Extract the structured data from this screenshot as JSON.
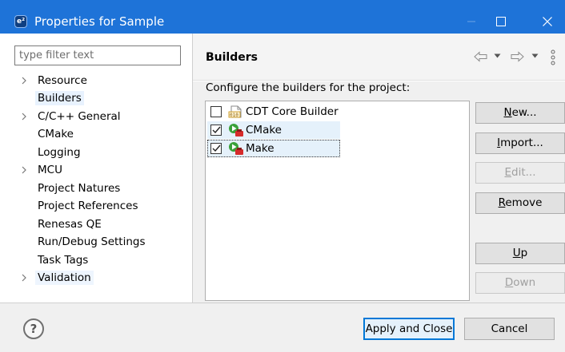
{
  "window": {
    "title": "Properties for Sample",
    "app_icon": "e²",
    "minimize_icon": "minimize-icon",
    "maximize_icon": "maximize-icon",
    "close_icon": "close-icon",
    "titlebar_color": "#1e73d8"
  },
  "filter": {
    "placeholder": "type filter text",
    "value": ""
  },
  "tree": [
    {
      "label": "Resource",
      "expandable": true
    },
    {
      "label": "Builders",
      "expandable": false,
      "selected": true
    },
    {
      "label": "C/C++ General",
      "expandable": true
    },
    {
      "label": "CMake",
      "expandable": false
    },
    {
      "label": "Logging",
      "expandable": false
    },
    {
      "label": "MCU",
      "expandable": true
    },
    {
      "label": "Project Natures",
      "expandable": false
    },
    {
      "label": "Project References",
      "expandable": false
    },
    {
      "label": "Renesas QE",
      "expandable": false
    },
    {
      "label": "Run/Debug Settings",
      "expandable": false
    },
    {
      "label": "Task Tags",
      "expandable": false
    },
    {
      "label": "Validation",
      "expandable": true,
      "hover": true
    }
  ],
  "page": {
    "title": "Builders",
    "description": "Configure the builders for the project:",
    "nav_icons": [
      "back-arrow-icon",
      "dropdown-icon",
      "forward-arrow-icon",
      "dropdown-icon",
      "view-menu-icon"
    ]
  },
  "builders": [
    {
      "label": "CDT Core Builder",
      "checked": false,
      "icon": "cdt-builder-icon"
    },
    {
      "label": "CMake",
      "checked": true,
      "icon": "external-builder-icon"
    },
    {
      "label": "Make",
      "checked": true,
      "icon": "external-builder-icon"
    }
  ],
  "buttons": {
    "new": {
      "mnemonic": "N",
      "rest": "ew..."
    },
    "import": {
      "mnemonic": "I",
      "rest": "mport..."
    },
    "edit": {
      "mnemonic": "E",
      "rest": "dit..."
    },
    "remove": {
      "mnemonic": "R",
      "rest": "emove"
    },
    "up": {
      "mnemonic": "U",
      "rest": "p"
    },
    "down": {
      "mnemonic": "D",
      "rest": "own"
    }
  },
  "footer": {
    "help": "?",
    "apply_close": "Apply and Close",
    "cancel": "Cancel"
  }
}
